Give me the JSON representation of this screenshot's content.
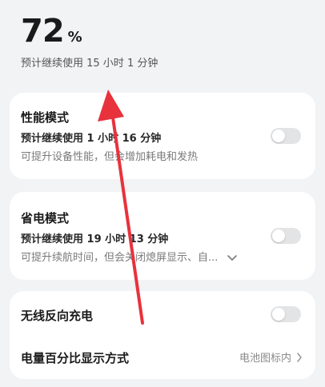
{
  "battery": {
    "level": "72",
    "unit": "%",
    "remaining": "预计继续使用 15 小时 1 分钟"
  },
  "performance": {
    "title": "性能模式",
    "estimate": "预计继续使用 1 小时 16 分钟",
    "desc": "可提升设备性能，但会增加耗电和发热",
    "enabled": false
  },
  "power_saving": {
    "title": "省电模式",
    "estimate": "预计继续使用 19 小时 13 分钟",
    "desc": "可提升续航时间，但会关闭熄屏显示、自...",
    "enabled": false
  },
  "wireless_reverse": {
    "title": "无线反向充电",
    "enabled": false
  },
  "percentage_display": {
    "title": "电量百分比显示方式",
    "value": "电池图标内"
  },
  "colors": {
    "annotation_arrow": "#e8323c",
    "toggle_off": "#e3e4e6"
  }
}
